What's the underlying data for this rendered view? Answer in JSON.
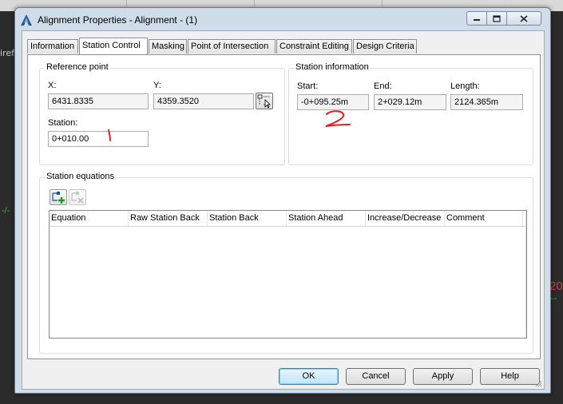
{
  "window": {
    "title": "Alignment Properties - Alignment - (1)",
    "icon": "autocad-civil-icon"
  },
  "title_buttons": {
    "minimize": "minimize-icon",
    "maximize": "maximize-icon",
    "close": "close-icon"
  },
  "tabs": [
    {
      "label": "Information",
      "active": false
    },
    {
      "label": "Station Control",
      "active": true
    },
    {
      "label": "Masking",
      "active": false
    },
    {
      "label": "Point of Intersection",
      "active": false
    },
    {
      "label": "Constraint Editing",
      "active": false
    },
    {
      "label": "Design Criteria",
      "active": false
    }
  ],
  "reference_point": {
    "title": "Reference point",
    "x_label": "X:",
    "x_value": "6431.8335",
    "y_label": "Y:",
    "y_value": "4359.3520",
    "station_label": "Station:",
    "station_value": "0+010.00"
  },
  "station_information": {
    "title": "Station information",
    "start_label": "Start:",
    "start_value": "-0+095.25m",
    "end_label": "End:",
    "end_value": "2+029.12m",
    "length_label": "Length:",
    "length_value": "2124.365m"
  },
  "station_equations": {
    "title": "Station equations",
    "columns": [
      "Equation",
      "Raw Station Back",
      "Station Back",
      "Station Ahead",
      "Increase/Decrease",
      "Comment"
    ],
    "rows": []
  },
  "buttons": {
    "ok": "OK",
    "cancel": "Cancel",
    "apply": "Apply",
    "help": "Help"
  },
  "background": {
    "left_text": "iref",
    "right_text": "20"
  },
  "colors": {
    "annotation_red": "#e02020",
    "title_bar": "#cfdcea"
  }
}
